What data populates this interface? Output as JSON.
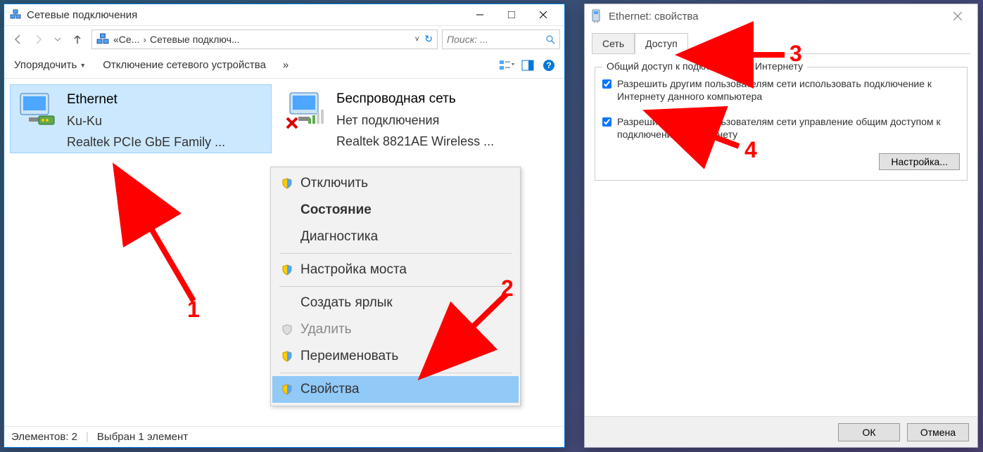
{
  "win1": {
    "title": "Сетевые подключения",
    "breadcrumb": {
      "part1": "Се...",
      "part2": "Сетевые подключ..."
    },
    "search_placeholder": "Поиск: ...",
    "toolbar": {
      "organize": "Упорядочить",
      "disable": "Отключение сетевого устройства"
    },
    "connections": {
      "ethernet": {
        "name": "Ethernet",
        "status": "Ku-Ku",
        "adapter": "Realtek PCIe GbE Family ..."
      },
      "wifi": {
        "name": "Беспроводная сеть",
        "status": "Нет подключения",
        "adapter": "Realtek 8821AE Wireless ..."
      }
    },
    "status": {
      "count": "Элементов: 2",
      "selected": "Выбран 1 элемент"
    }
  },
  "context_menu": {
    "disable": "Отключить",
    "status": "Состояние",
    "diagnose": "Диагностика",
    "bridge": "Настройка моста",
    "shortcut": "Создать ярлык",
    "delete": "Удалить",
    "rename": "Переименовать",
    "properties": "Свойства"
  },
  "win2": {
    "title": "Ethernet: свойства",
    "tabs": {
      "network": "Сеть",
      "access": "Доступ"
    },
    "fieldset_legend": "Общий доступ к подключению к Интернету",
    "chk1": "Разрешить другим пользователям сети использовать подключение к Интернету данного компьютера",
    "chk2": "Разрешить другим пользователям сети управление общим доступом к подключению к Интернету",
    "settings_btn": "Настройка...",
    "ok": "ОК",
    "cancel": "Отмена"
  },
  "annotations": {
    "n1": "1",
    "n2": "2",
    "n3": "3",
    "n4": "4"
  }
}
